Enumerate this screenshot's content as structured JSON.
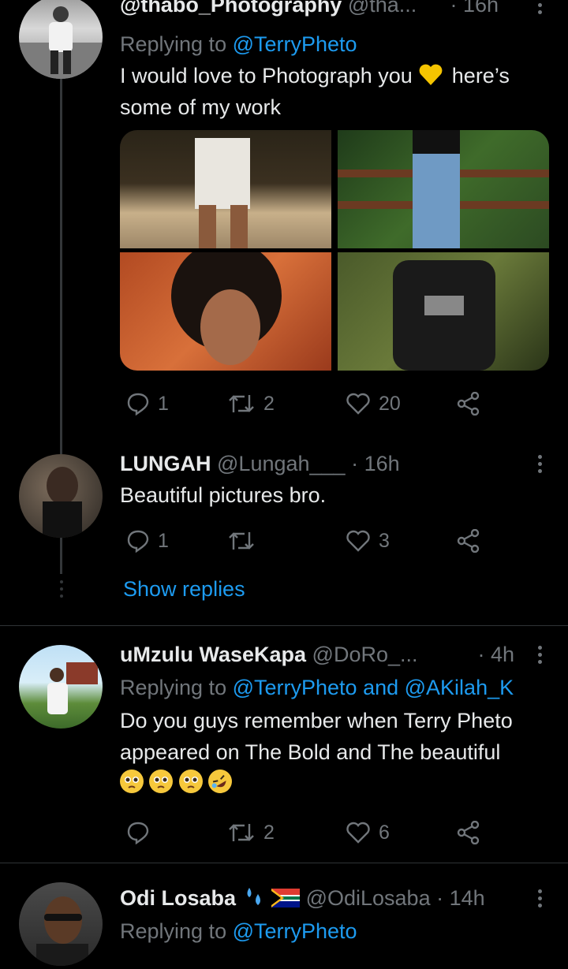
{
  "colors": {
    "accent": "#1d9bf0",
    "muted": "#71767b",
    "text": "#e7e9ea",
    "bg": "#000000"
  },
  "tweets": [
    {
      "display_name": "@thabo_Photography",
      "handle": "@tha...",
      "time": "· 16h",
      "replying_label": "Replying to",
      "replying_to": "@TerryPheto",
      "text": "I would love to Photograph you",
      "text_emoji": "yellow-heart",
      "text_after": "here’s some of my work",
      "reply_count": "1",
      "retweet_count": "2",
      "like_count": "20"
    },
    {
      "display_name": "LUNGAH",
      "handle": "@Lungah___",
      "time": "· 16h",
      "text": "Beautiful pictures bro.",
      "reply_count": "1",
      "retweet_count": "",
      "like_count": "3",
      "show_replies": "Show replies"
    },
    {
      "display_name": "uMzulu WaseKapa",
      "handle": "@DoRo_...",
      "time": "· 4h",
      "replying_label": "Replying to",
      "replying_to": "@TerryPheto and @AKilah_K",
      "text": "Do you guys remember when Terry Pheto appeared on The Bold and The beautiful",
      "emojis": [
        "pleading-face",
        "pleading-face",
        "pleading-face",
        "rolling-on-floor-laughing"
      ],
      "reply_count": "",
      "retweet_count": "2",
      "like_count": "6"
    },
    {
      "display_name": "Odi Losaba",
      "name_emojis": [
        "sweat-droplets",
        "south-africa-flag"
      ],
      "handle": "@OdiLosaba",
      "time": "· 14h",
      "replying_label": "Replying to",
      "replying_to": "@TerryPheto"
    }
  ]
}
